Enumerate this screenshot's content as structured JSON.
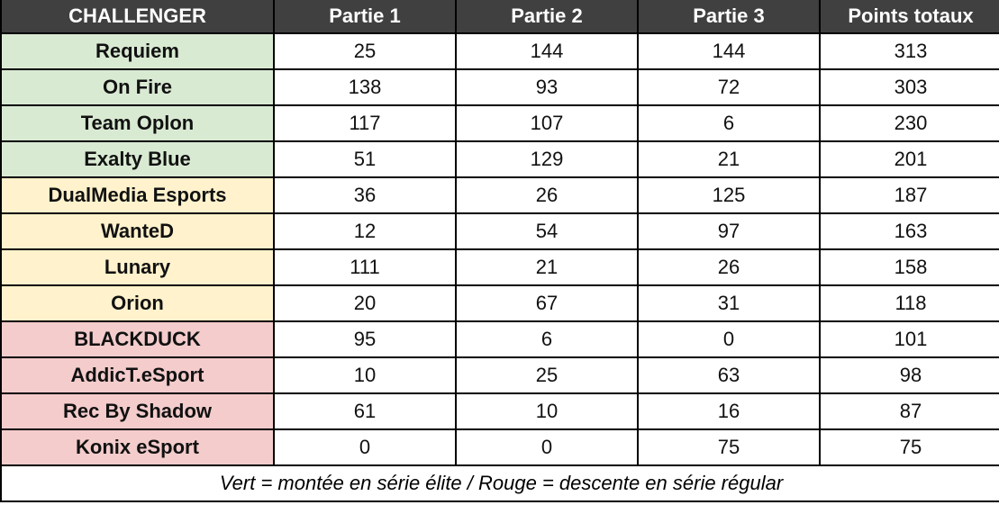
{
  "table": {
    "headers": [
      "CHALLENGER",
      "Partie 1",
      "Partie 2",
      "Partie 3",
      "Points totaux"
    ],
    "rows": [
      {
        "team": "Requiem",
        "p1": "25",
        "p2": "144",
        "p3": "144",
        "total": "313",
        "status": "green"
      },
      {
        "team": "On Fire",
        "p1": "138",
        "p2": "93",
        "p3": "72",
        "total": "303",
        "status": "green"
      },
      {
        "team": "Team Oplon",
        "p1": "117",
        "p2": "107",
        "p3": "6",
        "total": "230",
        "status": "green"
      },
      {
        "team": "Exalty Blue",
        "p1": "51",
        "p2": "129",
        "p3": "21",
        "total": "201",
        "status": "green"
      },
      {
        "team": "DualMedia Esports",
        "p1": "36",
        "p2": "26",
        "p3": "125",
        "total": "187",
        "status": "yellow"
      },
      {
        "team": "WanteD",
        "p1": "12",
        "p2": "54",
        "p3": "97",
        "total": "163",
        "status": "yellow"
      },
      {
        "team": "Lunary",
        "p1": "111",
        "p2": "21",
        "p3": "26",
        "total": "158",
        "status": "yellow"
      },
      {
        "team": "Orion",
        "p1": "20",
        "p2": "67",
        "p3": "31",
        "total": "118",
        "status": "yellow"
      },
      {
        "team": "BLACKDUCK",
        "p1": "95",
        "p2": "6",
        "p3": "0",
        "total": "101",
        "status": "red"
      },
      {
        "team": "AddicT.eSport",
        "p1": "10",
        "p2": "25",
        "p3": "63",
        "total": "98",
        "status": "red"
      },
      {
        "team": "Rec By Shadow",
        "p1": "61",
        "p2": "10",
        "p3": "16",
        "total": "87",
        "status": "red"
      },
      {
        "team": "Konix eSport",
        "p1": "0",
        "p2": "0",
        "p3": "75",
        "total": "75",
        "status": "red"
      }
    ],
    "footer": "Vert = montée en série élite / Rouge = descente en série régular"
  },
  "colors": {
    "header_bg": "#404040",
    "green": "#d9ead3",
    "yellow": "#fff2cc",
    "red": "#f4cccc"
  }
}
